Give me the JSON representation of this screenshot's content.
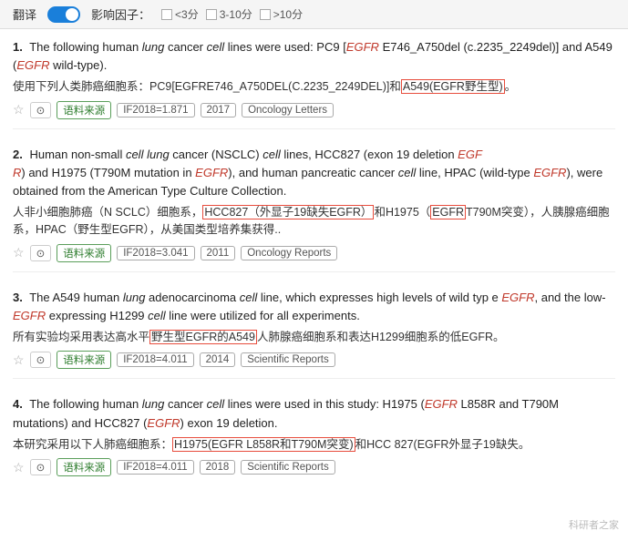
{
  "topbar": {
    "translate_label": "翻译",
    "toggle_on": true,
    "influence_label": "影响因子：",
    "filters": [
      {
        "label": "<3分",
        "checked": false
      },
      {
        "label": "3-10分",
        "checked": false
      },
      {
        "label": ">10分",
        "checked": false
      }
    ]
  },
  "results": [
    {
      "number": "1.",
      "en_text": "The following human lung cancer cell lines were used: PC9 [EGFR E746_A750del (c.2235_2249del)] and A549 (EGFR wild-type).",
      "zh_text": "使用下列人类肺癌细胞系：PC9[EGFRE746_A750DEL(C.2235_2249DEL)]和A549(EGFR野生型)。",
      "zh_highlight": "A549(EGFR野生型)",
      "tags": {
        "source": "语料来源",
        "if": "IF2018=1.871",
        "year": "2017",
        "journal": "Oncology Letters"
      }
    },
    {
      "number": "2.",
      "en_text": "Human non-small cell lung cancer (NSCLC) cell lines, HCC827 (exon 19 deletion EGFR) and H1975 (T790M mutation in EGFR), and human pancreatic cancer cell line, HPAC (wild-type EGFR), were obtained from the American Type Culture Collection.",
      "zh_text": "人非小细胞肺癌（N SCLC）细胞系，HCC827（外显子19缺失EGFR）和H1975（EGFR T790M突变），人胰腺癌细胞系，HPAC（野生型EGFR），从美国类型培养集获得..",
      "zh_highlight1": "HCC827（外显子19缺失EGFR）",
      "zh_highlight2": "EGFR",
      "tags": {
        "source": "语料来源",
        "if": "IF2018=3.041",
        "year": "2011",
        "journal": "Oncology Reports"
      }
    },
    {
      "number": "3.",
      "en_text": "The A549 human lung adenocarcinoma cell line, which expresses high levels of wild type EGFR, and the low-EGFR expressing H1299 cell line were utilized for all experiments.",
      "zh_text": "所有实验均采用表达高水平野生型EGFR的A549人肺腺癌细胞系和表达H1299细胞系的低EGFR。",
      "zh_highlight": "野生型EGFR的A549",
      "tags": {
        "source": "语料来源",
        "if": "IF2018=4.011",
        "year": "2014",
        "journal": "Scientific Reports"
      }
    },
    {
      "number": "4.",
      "en_text": "The following human lung cancer cell lines were used in this study: H1975 (EGFR L858R and T790M mutations) and HCC827 (EGFR exon 19 deletion.",
      "zh_text": "本研究采用以下人肺癌细胞系：H1975(EGFR L858R和T790M突变)和HCC 827(EGFR外显子19缺失。",
      "zh_highlight": "H1975(EGFR L858R和T790M突变)",
      "tags": {
        "source": "语料来源",
        "if": "IF2018=4.011",
        "year": "2018",
        "journal": "Scientific Reports"
      }
    }
  ],
  "watermark": "科研者之家"
}
